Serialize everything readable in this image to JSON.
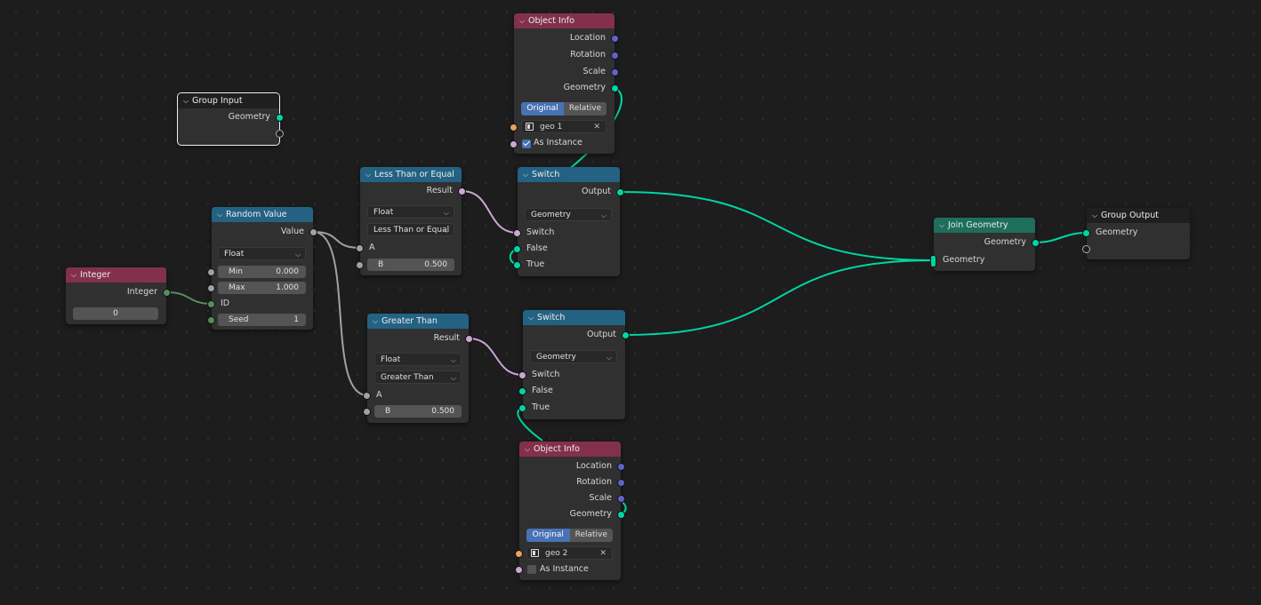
{
  "colors": {
    "background": "#1d1d1d",
    "node_body": "#303030",
    "header_object": "#83314a",
    "header_func": "#246283",
    "header_geo": "#1e6e5c",
    "socket_geometry": "#00d6a3",
    "socket_vector": "#6363c7",
    "socket_float": "#a1a1a1",
    "socket_boolean": "#cca6d6",
    "socket_integer": "#598c5c",
    "socket_object": "#ed9e5c",
    "toggle_active": "#4772b3"
  },
  "icons": {
    "collapse": "chevron-down-icon",
    "dropdown": "dropdown-arrow-icon",
    "object": "object-icon",
    "clear": "close-icon",
    "checkbox": "checkbox-icon"
  },
  "group_input": {
    "title": "Group Input",
    "outputs": [
      "Geometry"
    ]
  },
  "object_info_1": {
    "title": "Object Info",
    "outputs": [
      "Location",
      "Rotation",
      "Scale",
      "Geometry"
    ],
    "mode_original": "Original",
    "mode_relative": "Relative",
    "mode_selected": "Original",
    "object": "geo 1",
    "as_instance_label": "As Instance",
    "as_instance": true
  },
  "object_info_2": {
    "title": "Object Info",
    "outputs": [
      "Location",
      "Rotation",
      "Scale",
      "Geometry"
    ],
    "mode_original": "Original",
    "mode_relative": "Relative",
    "mode_selected": "Original",
    "object": "geo 2",
    "as_instance_label": "As Instance",
    "as_instance": false
  },
  "integer": {
    "title": "Integer",
    "output": "Integer",
    "value": "0"
  },
  "random_value": {
    "title": "Random Value",
    "output": "Value",
    "type": "Float",
    "min_label": "Min",
    "min": "0.000",
    "max_label": "Max",
    "max": "1.000",
    "id_label": "ID",
    "seed_label": "Seed",
    "seed": "1"
  },
  "less_than": {
    "title": "Less Than or Equal",
    "output": "Result",
    "type": "Float",
    "operation": "Less Than or Equal",
    "a_label": "A",
    "b_label": "B",
    "b": "0.500"
  },
  "greater_than": {
    "title": "Greater Than",
    "output": "Result",
    "type": "Float",
    "operation": "Greater Than",
    "a_label": "A",
    "b_label": "B",
    "b": "0.500"
  },
  "switch_1": {
    "title": "Switch",
    "output": "Output",
    "type": "Geometry",
    "inputs": [
      "Switch",
      "False",
      "True"
    ]
  },
  "switch_2": {
    "title": "Switch",
    "output": "Output",
    "type": "Geometry",
    "inputs": [
      "Switch",
      "False",
      "True"
    ]
  },
  "join_geometry": {
    "title": "Join Geometry",
    "output": "Geometry",
    "input": "Geometry"
  },
  "group_output": {
    "title": "Group Output",
    "input": "Geometry"
  }
}
